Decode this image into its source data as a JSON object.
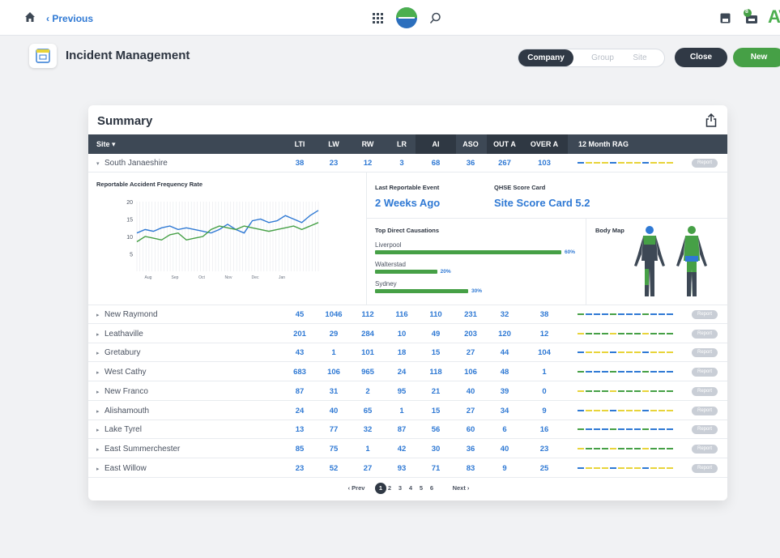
{
  "topbar": {
    "previous_label": "Previous",
    "brand_text": "AV",
    "notification_count": "8",
    "icons": [
      "home-icon",
      "grid-icon",
      "logo-icon",
      "search-icon",
      "save-icon",
      "notification-icon"
    ]
  },
  "header": {
    "title": "Incident Management",
    "scope_tabs": [
      {
        "label": "Company",
        "active": true
      },
      {
        "label": "Group",
        "active": false
      },
      {
        "label": "Site",
        "active": false
      }
    ],
    "close_label": "Close",
    "new_label": "New"
  },
  "summary": {
    "title": "Summary",
    "columns": [
      "Site",
      "LTI",
      "LW",
      "RW",
      "LR",
      "AI",
      "ASO",
      "OUT A",
      "OVER A",
      "12 Month RAG"
    ],
    "report_label": "Report",
    "expanded_row": {
      "site": "South Janaeshire",
      "values": [
        "38",
        "23",
        "12",
        "3",
        "68",
        "36",
        "267",
        "103"
      ]
    },
    "detail": {
      "chart_title": "Reportable Accident Frequency Rate",
      "last_event_label": "Last Reportable Event",
      "last_event_value": "2 Weeks Ago",
      "score_card_label": "QHSE Score Card",
      "score_card_value": "Site Score Card 5.2",
      "causations_title": "Top Direct Causations",
      "causations": [
        {
          "name": "Liverpool",
          "percent": 60,
          "label": "60%"
        },
        {
          "name": "Walterstad",
          "percent": 20,
          "label": "20%"
        },
        {
          "name": "Sydney",
          "percent": 30,
          "label": "30%"
        }
      ],
      "body_map_label": "Body Map"
    },
    "rows": [
      {
        "site": "New Raymond",
        "values": [
          "45",
          "1046",
          "112",
          "116",
          "110",
          "231",
          "32",
          "38"
        ]
      },
      {
        "site": "Leathaville",
        "values": [
          "201",
          "29",
          "284",
          "10",
          "49",
          "203",
          "120",
          "12"
        ]
      },
      {
        "site": "Gretabury",
        "values": [
          "43",
          "1",
          "101",
          "18",
          "15",
          "27",
          "44",
          "104"
        ]
      },
      {
        "site": "West Cathy",
        "values": [
          "683",
          "106",
          "965",
          "24",
          "118",
          "106",
          "48",
          "1"
        ]
      },
      {
        "site": "New Franco",
        "values": [
          "87",
          "31",
          "2",
          "95",
          "21",
          "40",
          "39",
          "0"
        ]
      },
      {
        "site": "Alishamouth",
        "values": [
          "24",
          "40",
          "65",
          "1",
          "15",
          "27",
          "34",
          "9"
        ]
      },
      {
        "site": "Lake Tyrel",
        "values": [
          "13",
          "77",
          "32",
          "87",
          "56",
          "60",
          "6",
          "16"
        ]
      },
      {
        "site": "East Summerchester",
        "values": [
          "85",
          "75",
          "1",
          "42",
          "30",
          "36",
          "40",
          "23"
        ]
      },
      {
        "site": "East Willow",
        "values": [
          "23",
          "52",
          "27",
          "93",
          "71",
          "83",
          "9",
          "25"
        ]
      }
    ],
    "pagination": {
      "prev_label": "‹ Prev",
      "next_label": "Next ›",
      "pages": [
        "1",
        "2",
        "3",
        "4",
        "5",
        "6"
      ],
      "current": "1"
    }
  },
  "colors": {
    "accent_blue": "#2f79d4",
    "accent_green": "#46a046",
    "dark": "#303945",
    "rag_green": "#46a046",
    "rag_yellow": "#e8d43a",
    "rag_blue": "#2f79d4"
  },
  "chart_data": {
    "type": "line",
    "title": "Reportable Accident Frequency Rate",
    "categories": [
      "Aug",
      "Sep",
      "Oct",
      "Nov",
      "Dec",
      "Jan"
    ],
    "ylim": [
      0,
      20
    ],
    "yticks": [
      5,
      10,
      15,
      20
    ],
    "series": [
      {
        "color": "#2f79d4",
        "values": [
          11,
          12,
          11.5,
          12.5,
          13,
          12,
          12.5,
          12,
          11.5,
          11,
          12,
          13.5,
          12,
          11,
          14.5,
          15,
          14,
          14.5,
          16,
          15,
          14,
          16,
          17.5
        ]
      },
      {
        "color": "#46a046",
        "values": [
          8.5,
          10,
          9.5,
          9,
          10.5,
          11,
          9,
          9.5,
          10,
          12,
          13,
          12.5,
          12,
          13,
          12.5,
          12,
          11.5,
          12,
          12.5,
          13,
          12,
          13,
          14
        ]
      }
    ]
  }
}
